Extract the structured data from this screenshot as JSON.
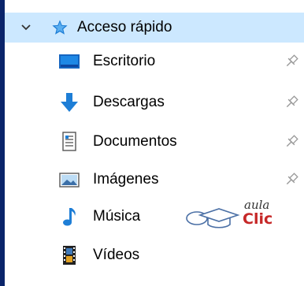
{
  "quick_access": {
    "label": "Acceso rápido"
  },
  "items": [
    {
      "label": "Escritorio",
      "icon": "desktop-icon",
      "pinned": true
    },
    {
      "label": "Descargas",
      "icon": "download-arrow-icon",
      "pinned": true
    },
    {
      "label": "Documentos",
      "icon": "document-icon",
      "pinned": true
    },
    {
      "label": "Imágenes",
      "icon": "pictures-icon",
      "pinned": true
    },
    {
      "label": "Música",
      "icon": "music-note-icon",
      "pinned": false
    },
    {
      "label": "Vídeos",
      "icon": "film-icon",
      "pinned": false
    }
  ],
  "watermark": {
    "top_text": "aula",
    "main_text": "Clic"
  },
  "colors": {
    "selection": "#cce8ff",
    "left_border": "#0a246a",
    "accent_blue": "#1e7ed6",
    "logo_red": "#c62828"
  }
}
